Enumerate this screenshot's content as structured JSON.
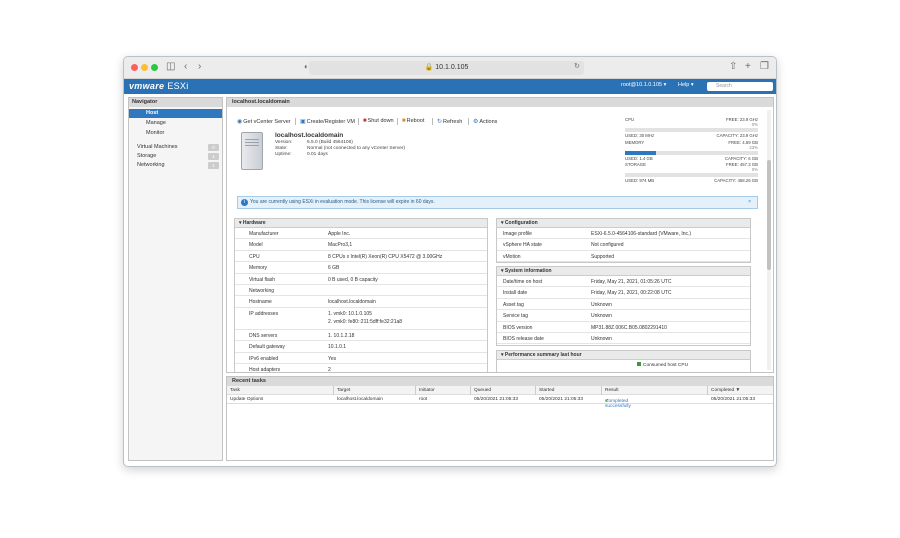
{
  "browser": {
    "url": "10.1.0.105"
  },
  "app": {
    "brand": "vmware",
    "product": "ESXi",
    "user_menu": "root@10.1.0.105",
    "help_menu": "Help",
    "search_placeholder": "Search"
  },
  "navigator": {
    "title": "Navigator",
    "host": "Host",
    "host_items": [
      "Manage",
      "Monitor"
    ],
    "groups": [
      {
        "label": "Virtual Machines",
        "count": "0"
      },
      {
        "label": "Storage",
        "count": "1"
      },
      {
        "label": "Networking",
        "count": "1"
      }
    ]
  },
  "main": {
    "breadcrumb": "localhost.localdomain",
    "toolbar": [
      "Get vCenter Server",
      "Create/Register VM",
      "Shut down",
      "Reboot",
      "Refresh",
      "Actions"
    ],
    "host": {
      "name": "localhost.localdomain",
      "details": [
        {
          "k": "Version:",
          "v": "6.5.0 (Build 4564106)"
        },
        {
          "k": "State:",
          "v": "Normal (not connected to any vCenter Server)"
        },
        {
          "k": "Uptime:",
          "v": "0.01 days"
        }
      ]
    },
    "resources": [
      {
        "name": "CPU",
        "free": "FREE: 23.9 GHz",
        "pct": "0%",
        "pct_value": 0,
        "used": "USED: 30 MHz",
        "capacity": "CAPACITY: 23.9 GHz"
      },
      {
        "name": "MEMORY",
        "free": "FREE: 4.59 GB",
        "pct": "23%",
        "pct_value": 23,
        "used": "USED: 1.4 GB",
        "capacity": "CAPACITY: 6 GB"
      },
      {
        "name": "STORAGE",
        "free": "FREE: 457.3 GB",
        "pct": "0%",
        "pct_value": 0,
        "used": "USED: 974 MB",
        "capacity": "CAPACITY: 458.26 GB"
      }
    ],
    "notice": "You are currently using ESXi in evaluation mode. This license will expire in 60 days.",
    "hardware": {
      "title": "Hardware",
      "rows": [
        {
          "k": "Manufacturer",
          "v": "Apple Inc."
        },
        {
          "k": "Model",
          "v": "MacPro3,1"
        },
        {
          "k": "CPU",
          "v": "8 CPUs x Intel(R) Xeon(R) CPU X5472 @ 3.00GHz"
        },
        {
          "k": "Memory",
          "v": "6 GB"
        },
        {
          "k": "Virtual flash",
          "v": "0 B used, 0 B capacity"
        },
        {
          "k": "Networking",
          "v": ""
        },
        {
          "k": "Hostname",
          "v": "localhost.localdomain"
        },
        {
          "k": "IP addresses",
          "v": "1. vmk0: 10.1.0.105",
          "v2": "2. vmk0: fe80::211:5dff:fe32:21a8"
        },
        {
          "k": "DNS servers",
          "v": "1. 10.1.2.18"
        },
        {
          "k": "Default gateway",
          "v": "10.1.0.1"
        },
        {
          "k": "IPv6 enabled",
          "v": "Yes"
        },
        {
          "k": "Host adapters",
          "v": "2"
        }
      ]
    },
    "configuration": {
      "title": "Configuration",
      "rows": [
        {
          "k": "Image profile",
          "v": "ESXi-6.5.0-4564106-standard (VMware, Inc.)"
        },
        {
          "k": "vSphere HA state",
          "v": "Not configured"
        },
        {
          "k": "vMotion",
          "v": "Supported"
        }
      ]
    },
    "system": {
      "title": "System information",
      "rows": [
        {
          "k": "Date/time on host",
          "v": "Friday, May 21, 2021, 01:05:26 UTC"
        },
        {
          "k": "Install date",
          "v": "Friday, May 21, 2021, 00:22:08 UTC"
        },
        {
          "k": "Asset tag",
          "v": "Unknown"
        },
        {
          "k": "Service tag",
          "v": "Unknown"
        },
        {
          "k": "BIOS version",
          "v": "MP31.88Z.006C.B05.0802291410"
        },
        {
          "k": "BIOS release date",
          "v": "Unknown"
        }
      ]
    },
    "performance": {
      "title": "Performance summary last hour",
      "legend": "Consumed host CPU"
    }
  },
  "tasks": {
    "title": "Recent tasks",
    "columns": [
      "Task",
      "Target",
      "Initiator",
      "Queued",
      "Started",
      "Result",
      "Completed ▼"
    ],
    "rows": [
      {
        "task": "Update Options",
        "target": "localhost.localdomain",
        "initiator": "root",
        "queued": "05/20/2021 21:05:33",
        "started": "05/20/2021 21:05:33",
        "result": "Completed successfully",
        "completed": "05/20/2021 21:05:33"
      }
    ]
  },
  "colors": {
    "brand_blue": "#2b72b4",
    "accent": "#2e78bf",
    "success": "#3a9a3a"
  }
}
